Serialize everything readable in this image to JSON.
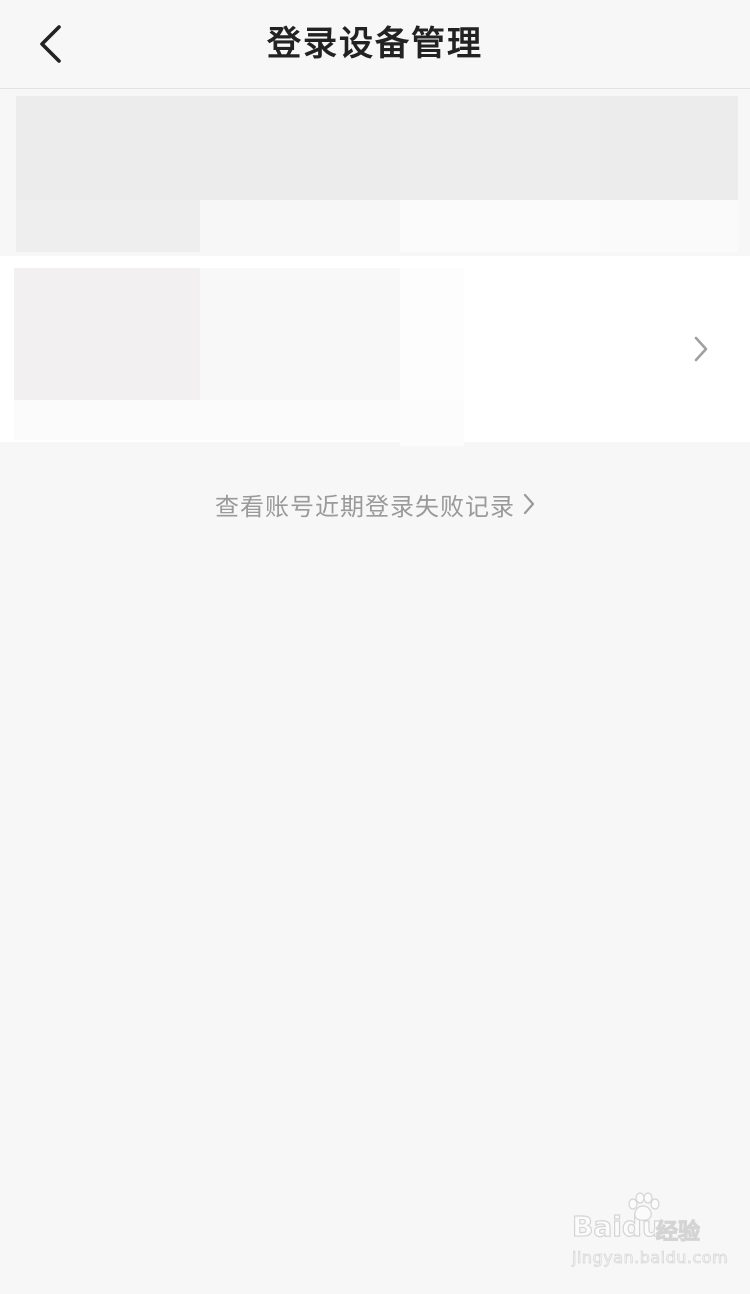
{
  "header": {
    "title": "登录设备管理",
    "back_icon": "chevron-left-icon"
  },
  "devices": {
    "row_chevron_icon": "chevron-right-icon"
  },
  "failed_login": {
    "label": "查看账号近期登录失败记录",
    "icon": "chevron-right-icon"
  },
  "watermark": {
    "brand": "Bai",
    "brand_suffix": "du",
    "cn": "经验",
    "url": "jingyan.baidu.com"
  },
  "colors": {
    "background": "#f7f7f7",
    "title": "#222222",
    "link_text": "#9a9a9a",
    "chevron": "#a0a0a0"
  }
}
